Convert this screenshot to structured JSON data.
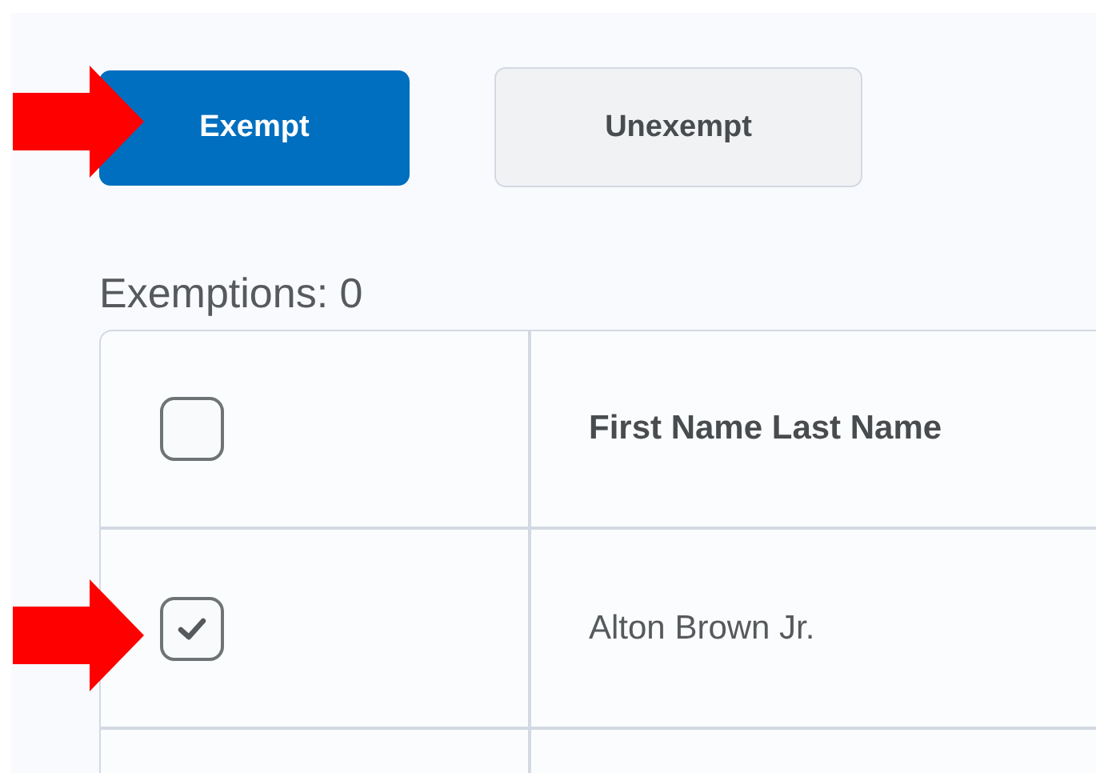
{
  "buttons": [
    {
      "label": "Exempt",
      "kind": "primary"
    },
    {
      "label": "Unexempt",
      "kind": "secondary"
    }
  ],
  "count_label": "Exemptions: 0",
  "table": {
    "header": {
      "checked": false,
      "column_label": "First Name Last Name"
    },
    "rows": [
      {
        "checked": true,
        "name": "Alton Brown Jr."
      }
    ]
  }
}
